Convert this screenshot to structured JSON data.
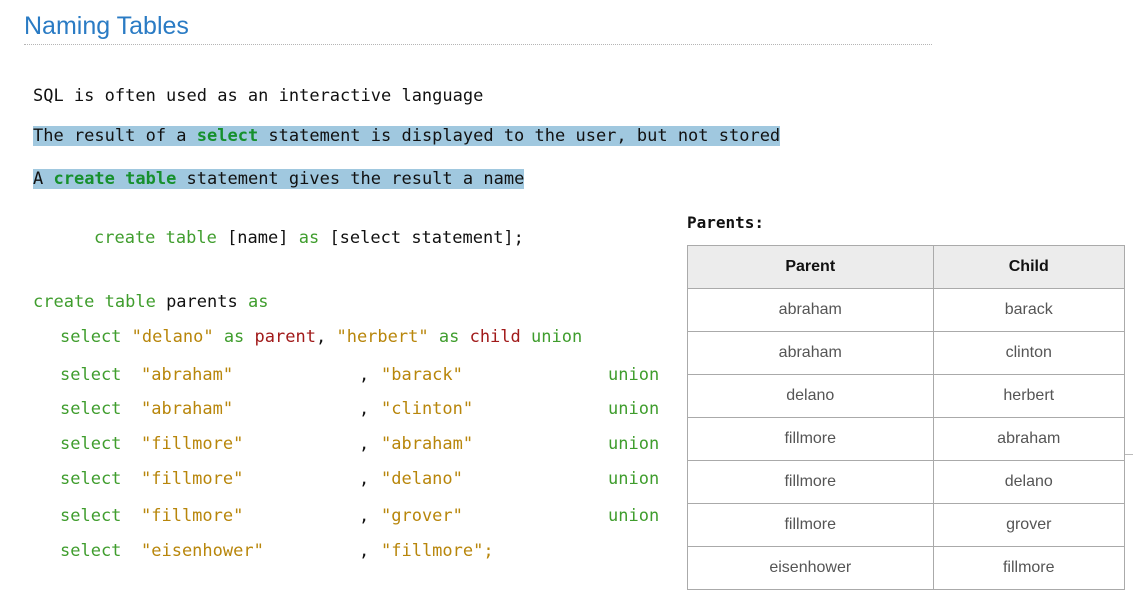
{
  "title": "Naming Tables",
  "lines": {
    "l1": "SQL is often used as an interactive language",
    "l2_pre": "The result of a ",
    "l2_kw": "select",
    "l2_post": " statement is displayed to the user, but not stored",
    "l3_pre": "A ",
    "l3_kw": "create table",
    "l3_post": " statement gives the result a name"
  },
  "syntax": {
    "create_table_as": "create table",
    "name": " [name] ",
    "as": "as",
    "select_stmt": " [select statement];"
  },
  "code": {
    "header_kw": "create table",
    "header_name": " parents ",
    "header_as": "as",
    "rows": [
      {
        "s1": "\"delano\"",
        "as1": "as",
        "c1": "parent",
        "s2": "\"herbert\"",
        "as2": "as",
        "c2": "child",
        "u": "union"
      },
      {
        "s1": "\"abraham\"",
        "s2": "\"barack\"",
        "u": "union"
      },
      {
        "s1": "\"abraham\"",
        "s2": "\"clinton\"",
        "u": "union"
      },
      {
        "s1": "\"fillmore\"",
        "s2": "\"abraham\"",
        "u": "union"
      },
      {
        "s1": "\"fillmore\"",
        "s2": "\"delano\"",
        "u": "union"
      },
      {
        "s1": "\"fillmore\"",
        "s2": "\"grover\"",
        "u": "union"
      },
      {
        "s1": "\"eisenhower\"",
        "s2": "\"fillmore\";",
        "u": ""
      }
    ],
    "select_kw": "select",
    "comma": ","
  },
  "table": {
    "label": "Parents:",
    "headers": [
      "Parent",
      "Child"
    ],
    "rows": [
      [
        "abraham",
        "barack"
      ],
      [
        "abraham",
        "clinton"
      ],
      [
        "delano",
        "herbert"
      ],
      [
        "fillmore",
        "abraham"
      ],
      [
        "fillmore",
        "delano"
      ],
      [
        "fillmore",
        "grover"
      ],
      [
        "eisenhower",
        "fillmore"
      ]
    ]
  }
}
